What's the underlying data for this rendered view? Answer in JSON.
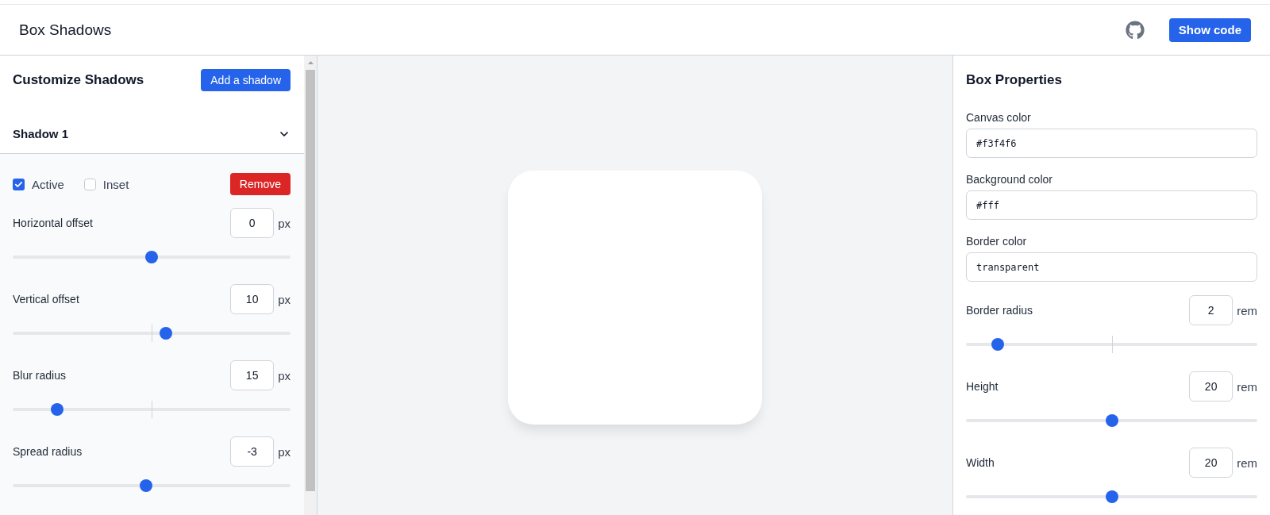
{
  "header": {
    "title": "Box Shadows",
    "button": "Show code"
  },
  "shadows_panel": {
    "title": "Customize Shadows",
    "add_button": "Add a shadow",
    "shadows": [
      {
        "title": "Shadow 1",
        "expanded": true,
        "active": {
          "label": "Active",
          "checked": true
        },
        "inset": {
          "label": "Inset",
          "checked": false
        },
        "remove_button": "Remove",
        "controls": [
          {
            "label": "Horizontal offset",
            "value": "0",
            "unit": "px",
            "level": 0.5,
            "tick": false
          },
          {
            "label": "Vertical offset",
            "value": "10",
            "unit": "px",
            "level": 0.55,
            "tick": true
          },
          {
            "label": "Blur radius",
            "value": "15",
            "unit": "px",
            "level": 0.16,
            "tick": true
          },
          {
            "label": "Spread radius",
            "value": "-3",
            "unit": "px",
            "level": 0.48,
            "tick": false
          }
        ]
      }
    ]
  },
  "box_properties": {
    "title": "Box Properties",
    "color_fields": [
      {
        "label": "Canvas color",
        "value": "#f3f4f6"
      },
      {
        "label": "Background color",
        "value": "#fff"
      },
      {
        "label": "Border color",
        "value": "transparent"
      }
    ],
    "sliders": [
      {
        "label": "Border radius",
        "value": "2",
        "unit": "rem",
        "level": 0.11,
        "tick": true
      },
      {
        "label": "Height",
        "value": "20",
        "unit": "rem",
        "level": 0.5,
        "tick": false
      },
      {
        "label": "Width",
        "value": "20",
        "unit": "rem",
        "level": 0.5,
        "tick": false
      }
    ]
  }
}
